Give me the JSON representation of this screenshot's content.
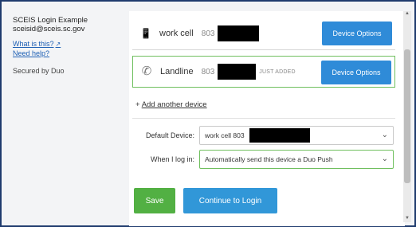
{
  "sidebar": {
    "org_name": "SCEIS Login Example",
    "org_email": "sceisid@sceis.sc.gov",
    "links": [
      "What is this?",
      "Need help?"
    ],
    "secured_by": "Secured by Duo"
  },
  "devices": [
    {
      "name": "work cell",
      "number": "803",
      "tag": "",
      "button": "Device Options",
      "icon": "phone-icon"
    },
    {
      "name": "Landline",
      "number": "803",
      "tag": "JUST ADDED",
      "button": "Device Options",
      "icon": "landline-icon"
    }
  ],
  "add_device": {
    "prefix": "+",
    "label": "Add another device"
  },
  "settings": {
    "default_device_label": "Default Device:",
    "default_device_value": "work cell 803",
    "when_login_label": "When I log in:",
    "when_login_value": "Automatically send this device a Duo Push"
  },
  "actions": {
    "save": "Save",
    "continue": "Continue to Login"
  }
}
